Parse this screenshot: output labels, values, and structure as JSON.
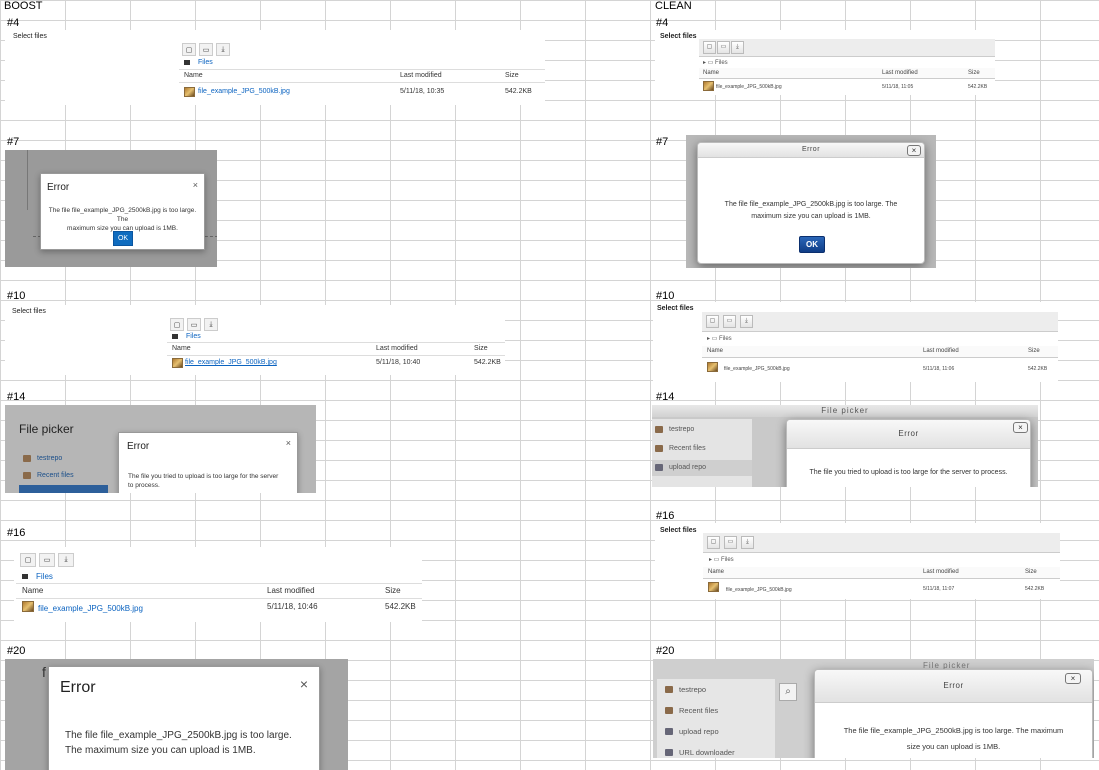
{
  "headers": {
    "boost": "BOOST",
    "clean": "CLEAN"
  },
  "labels": {
    "l4": "#4",
    "l7": "#7",
    "l10": "#10",
    "l14": "#14",
    "l16": "#16",
    "l20": "#20"
  },
  "filemanager": {
    "select_files": "Select files",
    "breadcrumb": "Files",
    "col_name": "Name",
    "col_modified": "Last modified",
    "col_size": "Size",
    "file_name": "file_example_JPG_500kB.jpg",
    "file_size": "542.2KB"
  },
  "times": {
    "b4": "5/11/18, 10:35",
    "c4": "5/11/18, 11:05",
    "b10": "5/11/18, 10:40",
    "c10": "5/11/18, 11:06",
    "b16": "5/11/18, 10:46",
    "c16": "5/11/18, 11:07"
  },
  "dialogs": {
    "error_title": "Error",
    "ok": "OK",
    "msg_size_1": "The file file_example_JPG_2500kB.jpg is too large. The",
    "msg_size_2": "maximum size you can upload is 1MB.",
    "msg_size_b1": "The file file_example_JPG_2500kB.jpg is too large. The",
    "msg_size_b2": "maximum size you can upload is 1MB.",
    "msg_server": "The file you tried to upload is too large for the server to process.",
    "msg_server_b1": "The file you tried to upload is too large for the server",
    "msg_server_b2": "to process.",
    "msg_20_b1": "The file file_example_JPG_2500kB.jpg is too large.",
    "msg_20_b2": "The maximum size you can upload is 1MB.",
    "msg_20_c1": "The file file_example_JPG_2500kB.jpg is too large. The maximum",
    "msg_20_c2": "size you can upload is 1MB."
  },
  "filepicker": {
    "title": "File picker",
    "repos": [
      "testrepo",
      "Recent files",
      "upload repo",
      "URL downloader"
    ]
  }
}
